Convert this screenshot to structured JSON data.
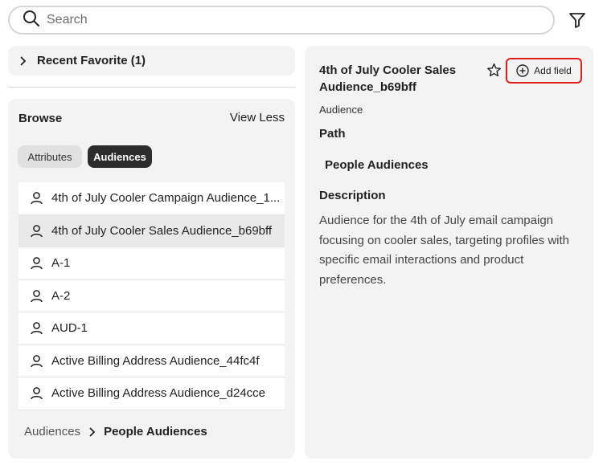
{
  "search": {
    "placeholder": "Search"
  },
  "recent": {
    "label": "Recent Favorite (1)"
  },
  "browse": {
    "title": "Browse",
    "toggle_label": "View Less",
    "chips": [
      "Attributes",
      "Audiences"
    ],
    "items": [
      "4th of July Cooler Campaign Audience_1...",
      "4th of July Cooler Sales Audience_b69bff",
      "A-1",
      "A-2",
      "AUD-1",
      "Active Billing Address Audience_44fc4f",
      "Active Billing Address Audience_d24cce"
    ],
    "breadcrumb": {
      "root": "Audiences",
      "current": "People Audiences"
    }
  },
  "detail": {
    "title": "4th of July Cooler Sales Audience_b69bff",
    "add_field_label": "Add field",
    "type": "Audience",
    "path_heading": "Path",
    "path_value": "People Audiences",
    "description_heading": "Description",
    "description": "Audience for the 4th of July email campaign focusing on cooler sales, targeting profiles with specific email interactions and product preferences."
  },
  "colors": {
    "highlight_border": "#e01e1e",
    "selected_chip": "#2c2c2c",
    "panel_bg": "#f3f3f3"
  },
  "icons": {
    "search": "search-icon",
    "filter": "filter-icon",
    "chevron": "chevron-right-icon",
    "user": "user-icon",
    "star": "star-icon",
    "add": "add-circle-icon"
  }
}
